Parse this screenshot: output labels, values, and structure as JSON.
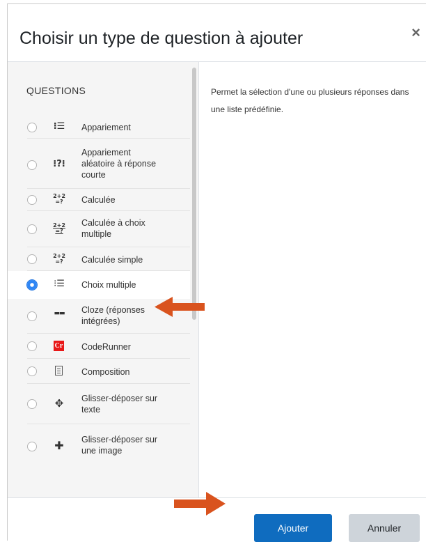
{
  "dialog": {
    "title": "Choisir un type de question à ajouter",
    "close_glyph": "×"
  },
  "questions": {
    "section_label": "QUESTIONS",
    "selected_index": 5,
    "items": [
      {
        "label": "Appariement",
        "icon": "match-icon",
        "glyph": "⁝☰"
      },
      {
        "label": "Appariement aléatoire à réponse courte",
        "icon": "random-match-icon",
        "glyph": "⁝?⁝"
      },
      {
        "label": "Calculée",
        "icon": "calculated-icon",
        "glyph": "2+2\n=?"
      },
      {
        "label": "Calculée à choix multiple",
        "icon": "calculated-multichoice-icon",
        "glyph": "2+2\n=?"
      },
      {
        "label": "Calculée simple",
        "icon": "calculated-simple-icon",
        "glyph": "2+2\n=?"
      },
      {
        "label": "Choix multiple",
        "icon": "multichoice-icon",
        "glyph": "⁝☰"
      },
      {
        "label": "Cloze (réponses intégrées)",
        "icon": "cloze-icon",
        "glyph": "▬▬"
      },
      {
        "label": "CodeRunner",
        "icon": "coderunner-icon",
        "glyph": "Cr"
      },
      {
        "label": "Composition",
        "icon": "essay-icon",
        "glyph": ""
      },
      {
        "label": "Glisser-déposer sur texte",
        "icon": "drag-drop-text-icon",
        "glyph": "✥"
      },
      {
        "label": "Glisser-déposer sur une image",
        "icon": "drag-drop-image-icon",
        "glyph": "✚"
      }
    ]
  },
  "description": "Permet la sélection d'une ou plusieurs réponses dans une liste prédéfinie.",
  "footer": {
    "add_label": "Ajouter",
    "cancel_label": "Annuler"
  },
  "colors": {
    "primary": "#0f6cbf",
    "arrow": "#d9531e",
    "selected_radio": "#2f86f5"
  }
}
